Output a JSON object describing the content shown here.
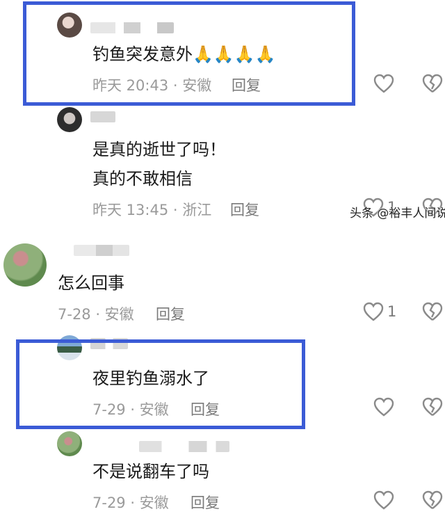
{
  "comments": [
    {
      "text": "钓鱼突发意外🙏🙏🙏🙏",
      "time": "昨天 20:43 · 安徽",
      "reply": "回复",
      "likes": ""
    },
    {
      "text_line1": "是真的逝世了吗！",
      "text_line2": "真的不敢相信",
      "time": "昨天 13:45 · 浙江",
      "reply": "回复",
      "likes": "1"
    },
    {
      "text": "怎么回事",
      "time": "7-28 · 安徽",
      "reply": "回复",
      "likes": "1"
    },
    {
      "text": "夜里钓鱼溺水了",
      "time": "7-29 · 安徽",
      "reply": "回复",
      "likes": ""
    },
    {
      "text": "不是说翻车了吗",
      "time": "7-29 · 安徽",
      "reply": "回复",
      "likes": ""
    }
  ],
  "watermark": "头条 @裕丰人间说",
  "colors": {
    "highlight": "#3b5bd6",
    "meta": "#9a9a9a"
  },
  "icons": {
    "like": "heart-outline-icon",
    "dislike": "broken-heart-icon"
  }
}
